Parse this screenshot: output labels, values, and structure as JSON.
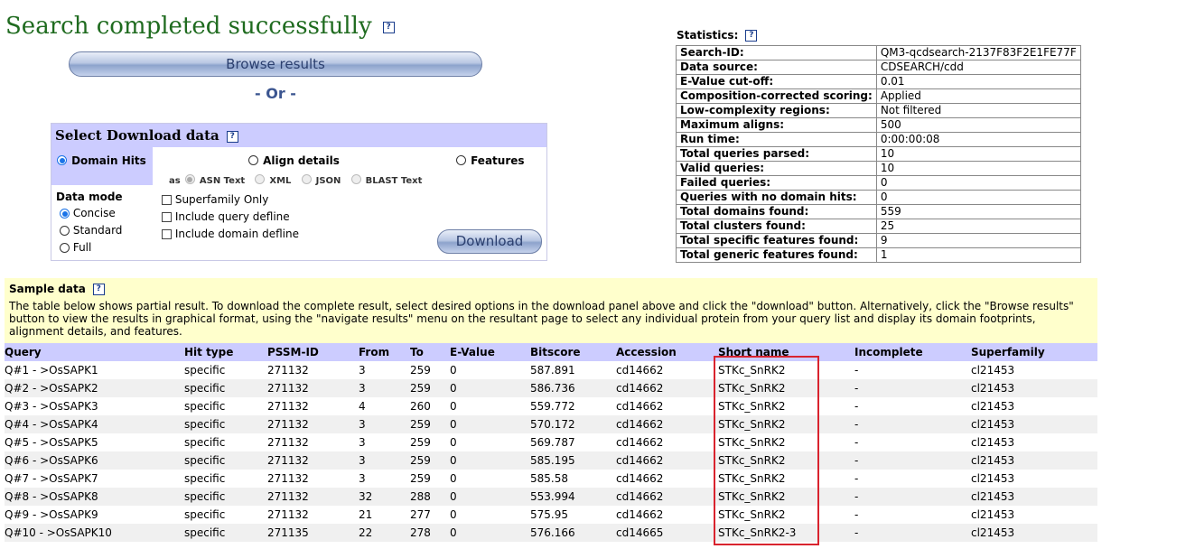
{
  "header": {
    "title": "Search completed successfully",
    "help": "?",
    "browse_label": "Browse results",
    "or_label": "- Or -"
  },
  "download": {
    "title": "Select Download data",
    "domain_hits": "Domain Hits",
    "align_details": "Align details",
    "features": "Features",
    "as_label": "as",
    "formats": [
      "ASN Text",
      "XML",
      "JSON",
      "BLAST Text"
    ],
    "data_mode_label": "Data mode",
    "modes": [
      "Concise",
      "Standard",
      "Full"
    ],
    "selected_mode": "Concise",
    "options": [
      "Superfamily Only",
      "Include query defline",
      "Include domain defline"
    ],
    "download_label": "Download"
  },
  "statistics": {
    "title": "Statistics:",
    "rows": [
      {
        "key": "Search-ID:",
        "value": "QM3-qcdsearch-2137F83F2E1FE77F"
      },
      {
        "key": "Data source:",
        "value": "CDSEARCH/cdd"
      },
      {
        "key": "E-Value cut-off:",
        "value": "0.01"
      },
      {
        "key": "Composition-corrected scoring:",
        "value": "Applied"
      },
      {
        "key": "Low-complexity regions:",
        "value": "Not filtered"
      },
      {
        "key": "Maximum aligns:",
        "value": "500"
      },
      {
        "key": "Run time:",
        "value": "0:00:00:08"
      },
      {
        "key": "Total queries parsed:",
        "value": "10"
      },
      {
        "key": "Valid queries:",
        "value": "10"
      },
      {
        "key": "Failed queries:",
        "value": "0"
      },
      {
        "key": "Queries with no domain hits:",
        "value": "0"
      },
      {
        "key": "Total domains found:",
        "value": "559"
      },
      {
        "key": "Total clusters found:",
        "value": "25"
      },
      {
        "key": "Total specific features found:",
        "value": "9"
      },
      {
        "key": "Total generic features found:",
        "value": "1"
      }
    ]
  },
  "sample": {
    "title": "Sample data",
    "description": "The table below shows partial result. To download the complete result, select desired options in the download panel above and click the \"download\" button. Alternatively, click the \"Browse results\" button to view the results in graphical format, using the \"navigate results\" menu on the resultant page to select any individual protein from your query list and display its domain footprints, alignment details, and features."
  },
  "results": {
    "columns": [
      "Query",
      "Hit type",
      "PSSM-ID",
      "From",
      "To",
      "E-Value",
      "Bitscore",
      "Accession",
      "Short name",
      "Incomplete",
      "Superfamily"
    ],
    "rows": [
      [
        "Q#1 - >OsSAPK1",
        "specific",
        "271132",
        "3",
        "259",
        "0",
        "587.891",
        "cd14662",
        "STKc_SnRK2",
        "-",
        "cl21453"
      ],
      [
        "Q#2 - >OsSAPK2",
        "specific",
        "271132",
        "3",
        "259",
        "0",
        "586.736",
        "cd14662",
        "STKc_SnRK2",
        "-",
        "cl21453"
      ],
      [
        "Q#3 - >OsSAPK3",
        "specific",
        "271132",
        "4",
        "260",
        "0",
        "559.772",
        "cd14662",
        "STKc_SnRK2",
        "-",
        "cl21453"
      ],
      [
        "Q#4 - >OsSAPK4",
        "specific",
        "271132",
        "3",
        "259",
        "0",
        "570.172",
        "cd14662",
        "STKc_SnRK2",
        "-",
        "cl21453"
      ],
      [
        "Q#5 - >OsSAPK5",
        "specific",
        "271132",
        "3",
        "259",
        "0",
        "569.787",
        "cd14662",
        "STKc_SnRK2",
        "-",
        "cl21453"
      ],
      [
        "Q#6 - >OsSAPK6",
        "specific",
        "271132",
        "3",
        "259",
        "0",
        "585.195",
        "cd14662",
        "STKc_SnRK2",
        "-",
        "cl21453"
      ],
      [
        "Q#7 - >OsSAPK7",
        "specific",
        "271132",
        "3",
        "259",
        "0",
        "585.58",
        "cd14662",
        "STKc_SnRK2",
        "-",
        "cl21453"
      ],
      [
        "Q#8 - >OsSAPK8",
        "specific",
        "271132",
        "32",
        "288",
        "0",
        "553.994",
        "cd14662",
        "STKc_SnRK2",
        "-",
        "cl21453"
      ],
      [
        "Q#9 - >OsSAPK9",
        "specific",
        "271132",
        "21",
        "277",
        "0",
        "575.95",
        "cd14662",
        "STKc_SnRK2",
        "-",
        "cl21453"
      ],
      [
        "Q#10 - >OsSAPK10",
        "specific",
        "271135",
        "22",
        "278",
        "0",
        "576.166",
        "cd14665",
        "STKc_SnRK2-3",
        "-",
        "cl21453"
      ]
    ]
  },
  "colors": {
    "title_green": "#1f6b1f",
    "panel_lavender": "#ccccff",
    "sample_yellow": "#ffffcc",
    "highlight_red": "#d9232e"
  }
}
